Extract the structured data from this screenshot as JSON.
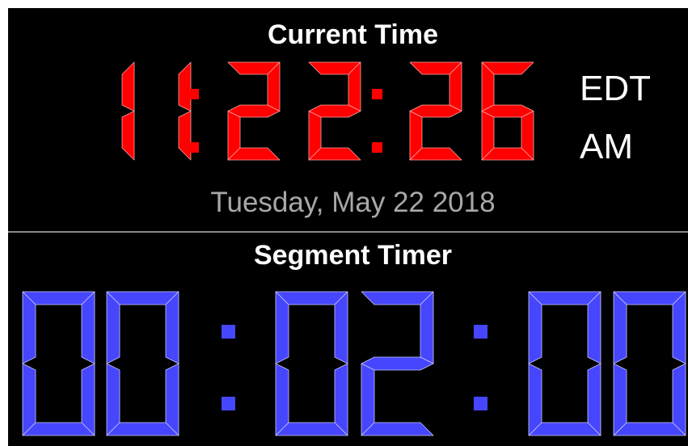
{
  "clock": {
    "title": "Current Time",
    "digits": [
      "1",
      "1",
      "2",
      "2",
      "2",
      "6"
    ],
    "time_text": "11:22:26",
    "timezone": "EDT",
    "meridiem": "AM",
    "date": "Tuesday, May 22 2018",
    "color": "#ff0000",
    "edge_color": "#ffa6a6"
  },
  "timer": {
    "title": "Segment Timer",
    "digits": [
      "0",
      "0",
      "0",
      "2",
      "0",
      "0"
    ],
    "time_text": "00:02:00",
    "color": "#4646ff",
    "edge_color": "#c8c8ff"
  },
  "colors": {
    "background": "#000000",
    "divider": "#8a8a8a",
    "date_text": "#a8a8a8"
  }
}
